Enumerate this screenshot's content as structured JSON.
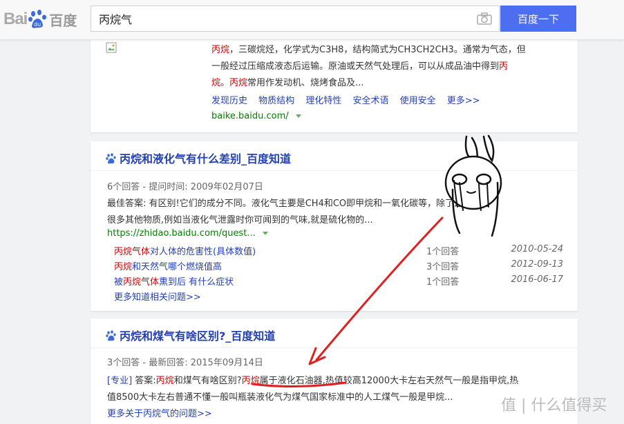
{
  "header": {
    "logo_text": "Bai",
    "logo_du": "du",
    "logo_cn": "百度",
    "query": "丙烷气",
    "search_button": "百度一下"
  },
  "baike": {
    "l1_a": "丙烷",
    "l1_b": "，三碳烷烃，化学式为C3H8，结构简式为CH3CH2CH3。通常为气态，但",
    "l2_a": "一般经过压缩成液态后运输。原油或天然气处理后，可以从成品油中得到",
    "l2_b": "丙",
    "l3_a": "烷",
    "l3_b": "。",
    "l3_c": "丙烷",
    "l3_d": "常用作发动机、烧烤食品及...",
    "links": [
      "发现历史",
      "物质结构",
      "理化特性",
      "安全术语",
      "使用安全",
      "更多>>"
    ],
    "url": "baike.baidu.com/"
  },
  "zhidao1": {
    "title": "丙烷和液化气有什么差别_百度知道",
    "meta": "6个回答 - 提问时间: 2009年02月07日",
    "ans1": "最佳答案: 有区别!它们的成分不同。液化气主要是CH4和CO即甲烷和一氧化碳等，除了这些还有",
    "ans2": "很多其他物质,例如当液化气泄露时你可闻到的气味,就是硫化物的...",
    "url": "https://zhidao.baidu.com/quest...",
    "rows": [
      {
        "q_red": "丙烷气体",
        "q_rest": "对人体的危害性(具体数值)",
        "n": "1个回答",
        "d": "2010-05-24"
      },
      {
        "q_red": "丙烷",
        "q_rest": "和天然气哪个燃烧值高",
        "n": "3个回答",
        "d": "2012-09-13"
      },
      {
        "q_pre": "被",
        "q_red": "丙烷气体",
        "q_rest": "熏到后 有什么症状",
        "n": "1个回答",
        "d": "2016-06-17"
      }
    ],
    "more": "更多知道相关问题>>"
  },
  "zhidao2": {
    "title": "丙烷和煤气有啥区别?_百度知道",
    "meta": "3个回答 - 最新回答: 2015年09月14日",
    "tag": "[专业]",
    "a_pre": " 答案:",
    "a_red1": "丙烷",
    "a_mid": "和煤气有啥区别?",
    "a_red2": "丙烷",
    "a_post": "属于液化石油器,热值较高12000大卡左右天然气一般是指甲烷,热",
    "line2": "值8500大卡左右普通不懂一般叫瓶装液化气为煤气国家标准中的人工煤气一般是甲烷...",
    "more": "更多关于丙烷气的问题>>"
  },
  "watermark": "值 | 什么值得买",
  "colors": {
    "accent": "#4e6ef2",
    "link": "#2440b3",
    "highlight": "#cc0000",
    "url": "#008000",
    "annotation": "#e02020"
  }
}
